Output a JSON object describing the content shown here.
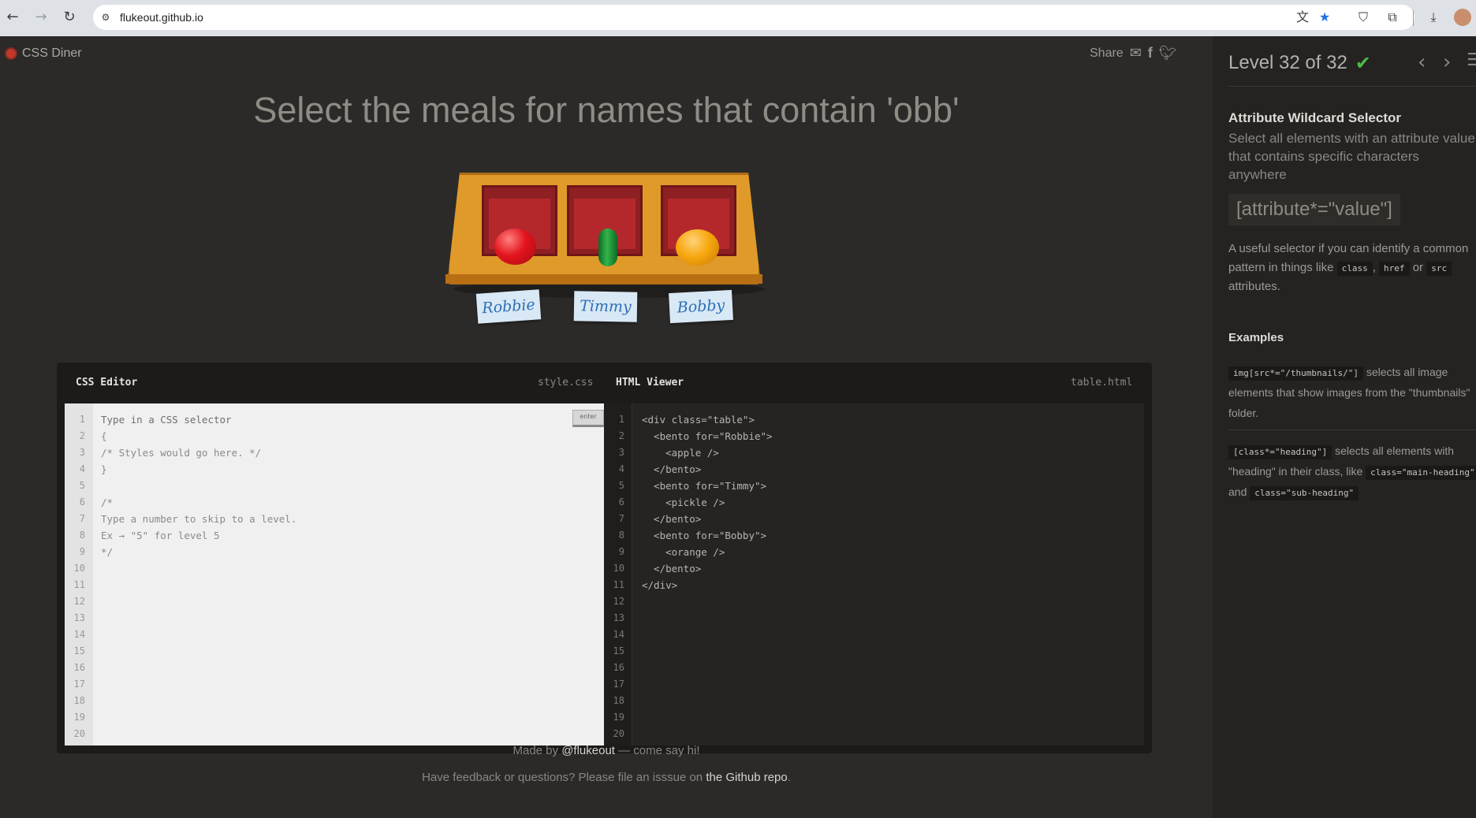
{
  "browser": {
    "url": "flukeout.github.io"
  },
  "header": {
    "logo_text": "CSS Diner",
    "share_label": "Share"
  },
  "instruction": "Select the meals for names that contain 'obb'",
  "table": {
    "names": [
      "Robbie",
      "Timmy",
      "Bobby"
    ]
  },
  "css_editor": {
    "title": "CSS Editor",
    "filename": "style.css",
    "enter_label": "enter",
    "placeholder": "Type in a CSS selector",
    "lines": [
      "{",
      "/* Styles would go here. */",
      "}",
      "",
      "/*",
      "Type a number to skip to a level.",
      "Ex → \"5\" for level 5",
      "*/"
    ],
    "line_numbers": [
      "1",
      "2",
      "3",
      "4",
      "5",
      "6",
      "7",
      "8",
      "9",
      "10",
      "11",
      "12",
      "13",
      "14",
      "15",
      "16",
      "17",
      "18",
      "19",
      "20"
    ]
  },
  "html_viewer": {
    "title": "HTML Viewer",
    "filename": "table.html",
    "lines": [
      "<div class=\"table\">",
      "  <bento for=\"Robbie\">",
      "    <apple />",
      "  </bento>",
      "  <bento for=\"Timmy\">",
      "    <pickle />",
      "  </bento>",
      "  <bento for=\"Bobby\">",
      "    <orange />",
      "  </bento>",
      "</div>"
    ]
  },
  "footer": {
    "made_by_prefix": "Made by ",
    "made_by_handle": "@flukeout",
    "made_by_suffix": " — come say hi!",
    "feedback_prefix": "Have feedback or questions? Please file an isssue on ",
    "feedback_link": "the Github repo",
    "feedback_suffix": "."
  },
  "sidebar": {
    "level_text": "Level 32 of 32",
    "selector_name": "Attribute Wildcard Selector",
    "selector_desc": "Select all elements with an attribute value that contains specific characters anywhere",
    "syntax": "[attribute*=\"value\"]",
    "hint_prefix": "A useful selector if you can identify a common pattern in things like ",
    "hint_tag1": "class",
    "hint_sep1": ", ",
    "hint_tag2": "href",
    "hint_sep2": " or ",
    "hint_tag3": "src",
    "hint_suffix": " attributes.",
    "examples_heading": "Examples",
    "ex1_code": "img[src*=\"/thumbnails/\"]",
    "ex1_text": " selects all image elements that show images from the \"thumbnails\" folder.",
    "ex2_code": "[class*=\"heading\"]",
    "ex2_text1": " selects all elements with \"heading\" in their class, like ",
    "ex2_code2": "class=\"main-heading\"",
    "ex2_text2": " and ",
    "ex2_code3": "class=\"sub-heading\""
  },
  "colors": {
    "page_bg": "#2b2a28",
    "sidebar_bg": "#242321",
    "check": "#4cbb46",
    "name_card_text": "#2b70b5"
  }
}
